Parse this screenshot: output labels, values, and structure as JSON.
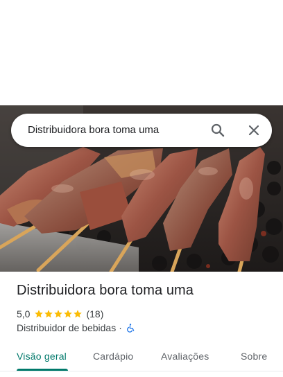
{
  "search": {
    "query": "Distribuidora bora toma uma",
    "search_icon": "search-icon",
    "close_icon": "close-icon"
  },
  "place": {
    "name": "Distribuidora bora toma uma",
    "rating": "5,0",
    "stars": 5,
    "max_stars": 5,
    "review_count": "(18)",
    "category": "Distribuidor de bebidas",
    "separator": "·",
    "accessibility_icon": "wheelchair-accessible-icon"
  },
  "tabs": [
    {
      "label": "Visão geral",
      "active": true
    },
    {
      "label": "Cardápio",
      "active": false
    },
    {
      "label": "Avaliações",
      "active": false
    },
    {
      "label": "Sobre",
      "active": false
    }
  ],
  "colors": {
    "star": "#fbbc04",
    "active_tab": "#00796b",
    "accessibility_icon": "#1a73e8"
  }
}
